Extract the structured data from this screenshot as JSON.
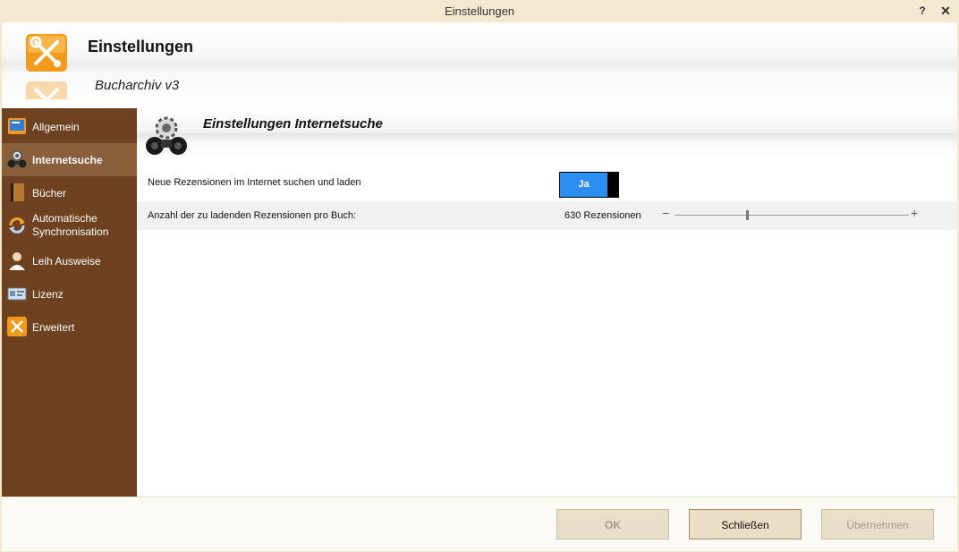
{
  "window": {
    "title": "Einstellungen",
    "help_label": "?",
    "close_label": "✕"
  },
  "header": {
    "title": "Einstellungen",
    "subtitle": "Bucharchiv v3"
  },
  "sidebar": {
    "items": [
      {
        "label": "Allgemein",
        "icon": "book-blue-icon",
        "active": false
      },
      {
        "label": "Internetsuche",
        "icon": "binoculars-gear-icon",
        "active": true
      },
      {
        "label": "Bücher",
        "icon": "book-brown-icon",
        "active": false
      },
      {
        "label": "Automatische\nSynchronisation",
        "icon": "sync-arrows-icon",
        "active": false
      },
      {
        "label": "Leih Ausweise",
        "icon": "person-icon",
        "active": false
      },
      {
        "label": "Lizenz",
        "icon": "license-card-icon",
        "active": false
      },
      {
        "label": "Erweitert",
        "icon": "tools-icon",
        "active": false
      }
    ]
  },
  "content": {
    "title": "Einstellungen Internetsuche",
    "rows": [
      {
        "label": "Neue Rezensionen im Internet suchen und laden",
        "toggle_label": "Ja",
        "toggle_on": true
      },
      {
        "label": "Anzahl der zu ladenden Rezensionen pro Buch:",
        "value_text": "630 Rezensionen",
        "minus": "−",
        "plus": "+",
        "slider_fraction": 0.31
      }
    ]
  },
  "footer": {
    "ok_label": "OK",
    "close_label": "Schließen",
    "apply_label": "Übernehmen"
  },
  "colors": {
    "sidebar_bg": "#6e4220",
    "sidebar_active": "#8a5f3c",
    "toggle_on": "#2b8ef0",
    "window_bg": "#f4e9cf"
  }
}
